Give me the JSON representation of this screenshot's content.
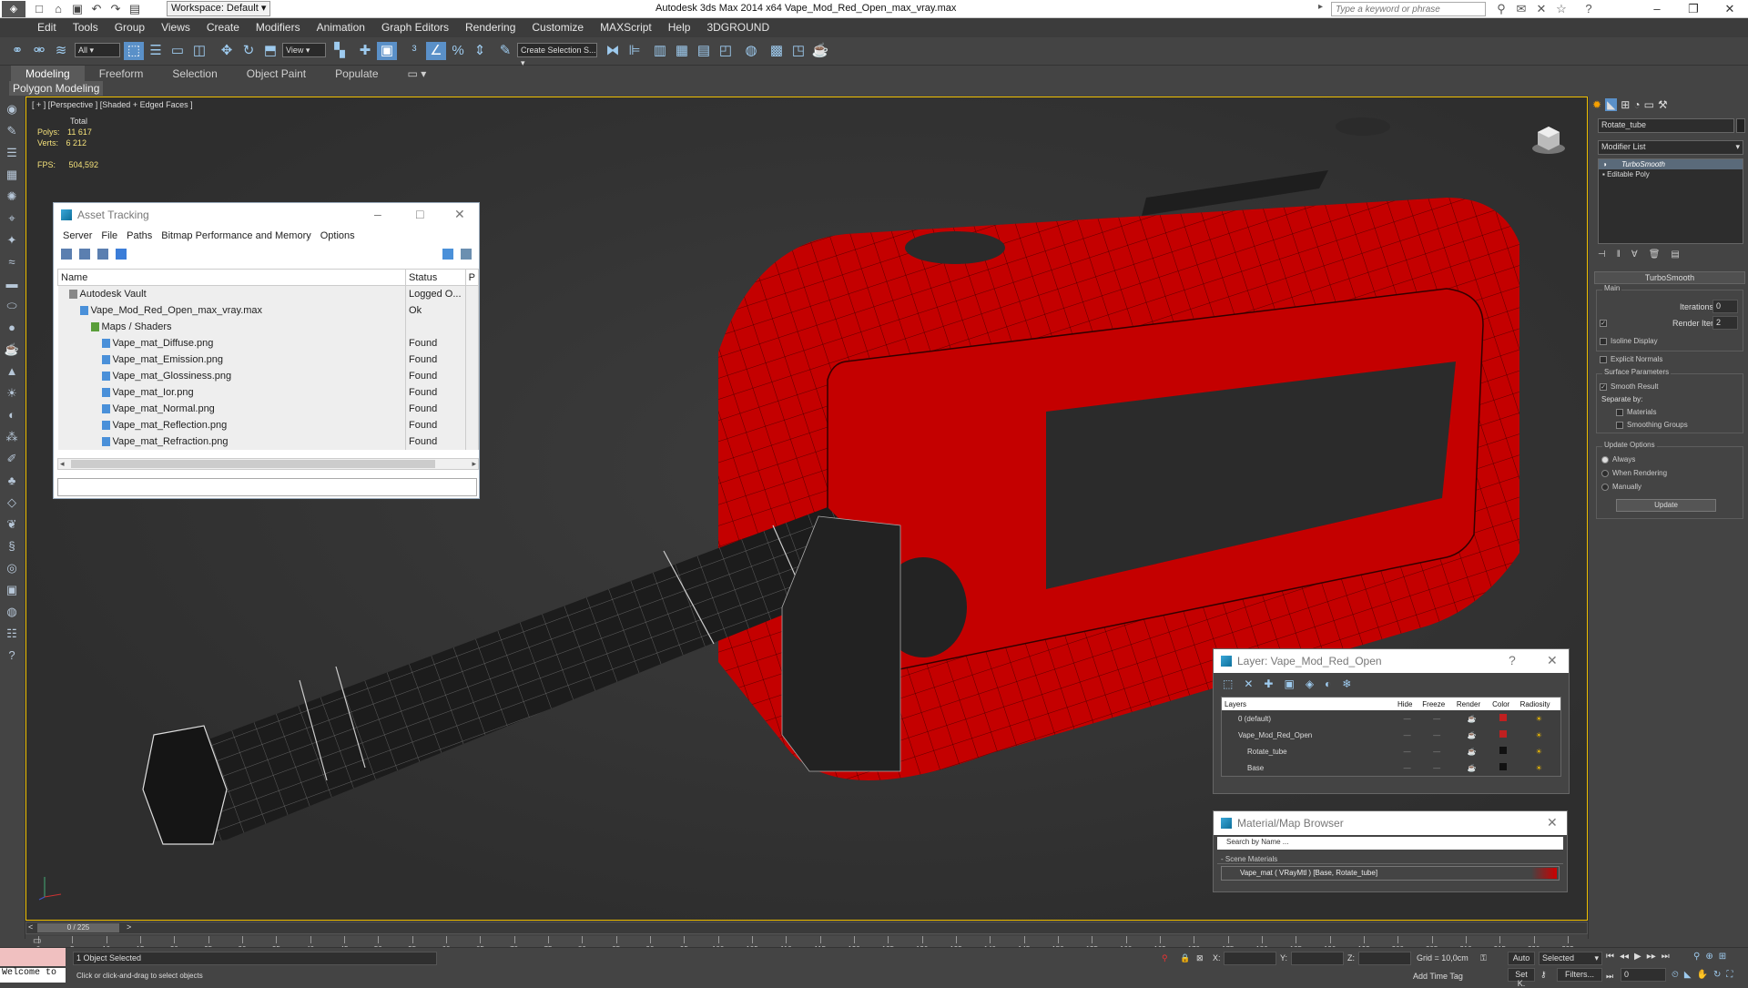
{
  "titlebar": {
    "workspace": "Workspace: Default",
    "title": "Autodesk 3ds Max  2014 x64       Vape_Mod_Red_Open_max_vray.max",
    "search_placeholder": "Type a keyword or phrase"
  },
  "menu": [
    "Edit",
    "Tools",
    "Group",
    "Views",
    "Create",
    "Modifiers",
    "Animation",
    "Graph Editors",
    "Rendering",
    "Customize",
    "MAXScript",
    "Help",
    "3DGROUND"
  ],
  "toolbar": {
    "filter": "All",
    "refcoord": "View",
    "selset": "Create Selection S..."
  },
  "ribbon": {
    "tabs": [
      "Modeling",
      "Freeform",
      "Selection",
      "Object Paint",
      "Populate"
    ],
    "active": "Modeling",
    "subtab": "Polygon Modeling"
  },
  "viewport": {
    "label": "[ + ] [Perspective ] [Shaded + Edged Faces ]",
    "stats": {
      "total": "Total",
      "polys_label": "Polys:",
      "polys": "11 617",
      "verts_label": "Verts:",
      "verts": "6 212",
      "fps_label": "FPS:",
      "fps": "504,592"
    }
  },
  "asset_tracking": {
    "title": "Asset Tracking",
    "menu": [
      "Server",
      "File",
      "Paths",
      "Bitmap Performance and Memory",
      "Options"
    ],
    "columns": [
      "Name",
      "Status",
      "P"
    ],
    "rows": [
      {
        "name": "Autodesk Vault",
        "status": "Logged O...",
        "indent": 0
      },
      {
        "name": "Vape_Mod_Red_Open_max_vray.max",
        "status": "Ok",
        "indent": 1
      },
      {
        "name": "Maps / Shaders",
        "status": "",
        "indent": 2
      },
      {
        "name": "Vape_mat_Diffuse.png",
        "status": "Found",
        "indent": 3
      },
      {
        "name": "Vape_mat_Emission.png",
        "status": "Found",
        "indent": 3
      },
      {
        "name": "Vape_mat_Glossiness.png",
        "status": "Found",
        "indent": 3
      },
      {
        "name": "Vape_mat_Ior.png",
        "status": "Found",
        "indent": 3
      },
      {
        "name": "Vape_mat_Normal.png",
        "status": "Found",
        "indent": 3
      },
      {
        "name": "Vape_mat_Reflection.png",
        "status": "Found",
        "indent": 3
      },
      {
        "name": "Vape_mat_Refraction.png",
        "status": "Found",
        "indent": 3
      }
    ]
  },
  "layer_window": {
    "title": "Layer: Vape_Mod_Red_Open",
    "columns": [
      "Layers",
      "Hide",
      "Freeze",
      "Render",
      "Color",
      "Radiosity"
    ],
    "rows": [
      {
        "name": "0 (default)",
        "color": "#c02020"
      },
      {
        "name": "Vape_Mod_Red_Open",
        "color": "#c02020"
      },
      {
        "name": "Rotate_tube",
        "color": "#111111"
      },
      {
        "name": "Base",
        "color": "#111111"
      }
    ]
  },
  "material_browser": {
    "title": "Material/Map Browser",
    "search": "Search by Name ...",
    "section": "- Scene Materials",
    "item": "Vape_mat  ( VRayMtl ) [Base, Rotate_tube]"
  },
  "command_panel": {
    "object_name": "Rotate_tube",
    "modifier_list": "Modifier List",
    "stack": [
      "TurboSmooth",
      "Editable Poly"
    ],
    "rollout": "TurboSmooth",
    "main": "Main",
    "iterations_label": "Iterations:",
    "iterations": "0",
    "render_iters_label": "Render Iters:",
    "render_iters": "2",
    "isoline": "Isoline Display",
    "explicit_normals": "Explicit Normals",
    "surface_params": "Surface Parameters",
    "smooth_result": "Smooth Result",
    "separate_by": "Separate by:",
    "materials": "Materials",
    "smoothing_groups": "Smoothing Groups",
    "update_options": "Update Options",
    "always": "Always",
    "when_rendering": "When Rendering",
    "manually": "Manually",
    "update_button": "Update"
  },
  "timeline": {
    "frame": "0 / 225",
    "ticks": [
      "0",
      "5",
      "10",
      "15",
      "20",
      "25",
      "30",
      "35",
      "40",
      "45",
      "50",
      "55",
      "60",
      "65",
      "70",
      "75",
      "80",
      "85",
      "90",
      "95",
      "100",
      "105",
      "110",
      "115",
      "120",
      "125",
      "130",
      "135",
      "140",
      "145",
      "150",
      "155",
      "160",
      "165",
      "170",
      "175",
      "180",
      "185",
      "190",
      "195",
      "200",
      "205",
      "210",
      "215",
      "220",
      "225"
    ]
  },
  "status": {
    "welcome": "Welcome to",
    "selected": "1 Object Selected",
    "prompt": "Click or click-and-drag to select objects",
    "x": "X:",
    "y": "Y:",
    "z": "Z:",
    "grid": "Grid = 10,0cm",
    "add_time_tag": "Add Time Tag",
    "auto": "Auto",
    "selected_mode": "Selected",
    "setk": "Set K.",
    "filters": "Filters...",
    "frame_field": "0"
  }
}
